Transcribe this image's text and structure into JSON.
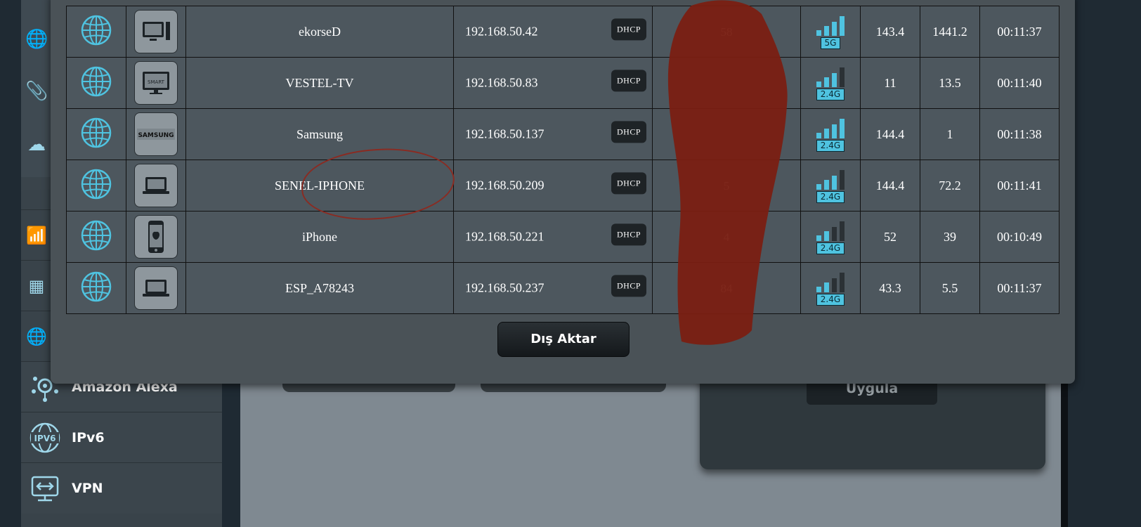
{
  "sidebar": {
    "items": [
      {
        "label": "Amazon Alexa",
        "icon": "alexa-icon"
      },
      {
        "label": "IPv6",
        "icon": "ipv6-icon"
      },
      {
        "label": "VPN",
        "icon": "vpn-icon"
      }
    ],
    "ipv6_icon_text": "IPV6"
  },
  "background": {
    "apply_label": "Uygula"
  },
  "clients": [
    {
      "name": "ekorseD",
      "ip": "192.168.50.42",
      "ip_type": "DHCP",
      "mac_visible": "58",
      "band": "5G",
      "signal": 4,
      "tx": "143.4",
      "rx": "1441.2",
      "time": "00:11:37",
      "device_icon": "desktop-icon"
    },
    {
      "name": "VESTEL-TV",
      "ip": "192.168.50.83",
      "ip_type": "DHCP",
      "mac_visible": "",
      "band": "2.4G",
      "signal": 3,
      "tx": "11",
      "rx": "13.5",
      "time": "00:11:40",
      "device_icon": "smart-tv-icon"
    },
    {
      "name": "Samsung",
      "ip": "192.168.50.137",
      "ip_type": "DHCP",
      "mac_visible": "",
      "band": "2.4G",
      "signal": 4,
      "tx": "144.4",
      "rx": "1",
      "time": "00:11:38",
      "device_icon": "samsung-logo-icon"
    },
    {
      "name": "SENEL-IPHONE",
      "ip": "192.168.50.209",
      "ip_type": "DHCP",
      "mac_visible": "5",
      "band": "2.4G",
      "signal": 3,
      "tx": "144.4",
      "rx": "72.2",
      "time": "00:11:41",
      "device_icon": "laptop-icon"
    },
    {
      "name": "iPhone",
      "ip": "192.168.50.221",
      "ip_type": "DHCP",
      "mac_visible": "4",
      "band": "2.4G",
      "signal": 2,
      "tx": "52",
      "rx": "39",
      "time": "00:10:49",
      "device_icon": "iphone-icon"
    },
    {
      "name": "ESP_A78243",
      "ip": "192.168.50.237",
      "ip_type": "DHCP",
      "mac_visible": "84",
      "band": "2.4G",
      "signal": 2,
      "tx": "43.3",
      "rx": "5.5",
      "time": "00:11:37",
      "device_icon": "laptop-icon"
    }
  ],
  "device_icon_text": {
    "smart": "SMART",
    "samsung": "SAMSUNG"
  },
  "export_label": "Dış Aktar",
  "colors": {
    "accent": "#4fc3e0",
    "modal_bg": "#4a5257",
    "signal_on": "#4fc3e0",
    "signal_off": "#2b3135",
    "redaction": "#7a1f12"
  }
}
